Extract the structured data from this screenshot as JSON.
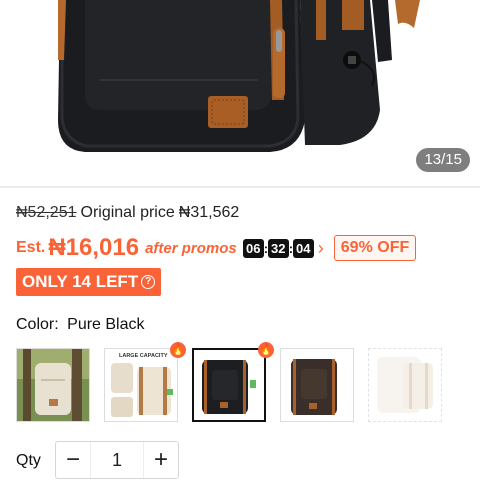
{
  "gallery": {
    "counter": "13/15"
  },
  "price": {
    "old": "₦52,251",
    "original_label": "Original price",
    "original": "₦31,562",
    "est_label": "Est.",
    "est": "₦16,016",
    "after_promos": "after promos",
    "timer": {
      "hours": "06",
      "minutes": "32",
      "seconds": "04"
    },
    "off_badge": "69% OFF"
  },
  "stock": {
    "only_left": "ONLY 14 LEFT"
  },
  "color": {
    "label": "Color:",
    "value": "Pure Black",
    "swatches": [
      {
        "name": "beige-in-forest",
        "selected": false,
        "hot": false,
        "available": true
      },
      {
        "name": "beige-large-capacity",
        "selected": false,
        "hot": true,
        "available": true,
        "caption": "LARGE CAPACITY"
      },
      {
        "name": "pure-black",
        "selected": true,
        "hot": true,
        "available": true
      },
      {
        "name": "coffee",
        "selected": false,
        "hot": false,
        "available": true
      },
      {
        "name": "white",
        "selected": false,
        "hot": false,
        "available": false
      }
    ]
  },
  "quantity": {
    "label": "Qty",
    "value": "1",
    "minus": "−",
    "plus": "+"
  },
  "colors": {
    "accent": "#fa6338",
    "black": "#111111"
  }
}
